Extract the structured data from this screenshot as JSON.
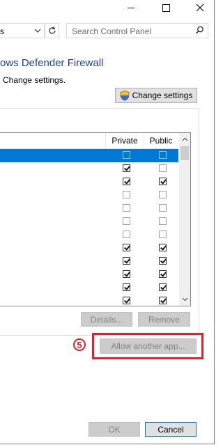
{
  "address": {
    "text": "s"
  },
  "search": {
    "placeholder": "Search Control Panel"
  },
  "header": {
    "title": "ows Defender Firewall",
    "subtitle": "Change settings."
  },
  "buttons": {
    "change_settings": "Change settings",
    "details": "Details...",
    "remove": "Remove",
    "allow_another_app": "Allow another app...",
    "ok": "OK",
    "cancel": "Cancel"
  },
  "table": {
    "columns": {
      "private": "Private",
      "public": "Public"
    },
    "rows": [
      {
        "selected": true,
        "private": false,
        "public": false
      },
      {
        "selected": false,
        "private": true,
        "public": false
      },
      {
        "selected": false,
        "private": true,
        "public": true
      },
      {
        "selected": false,
        "private": false,
        "public": false
      },
      {
        "selected": false,
        "private": false,
        "public": false
      },
      {
        "selected": false,
        "private": false,
        "public": false
      },
      {
        "selected": false,
        "private": false,
        "public": false
      },
      {
        "selected": false,
        "private": true,
        "public": true
      },
      {
        "selected": false,
        "private": true,
        "public": true
      },
      {
        "selected": false,
        "private": true,
        "public": true
      },
      {
        "selected": false,
        "private": true,
        "public": true
      },
      {
        "selected": false,
        "private": true,
        "public": true
      }
    ]
  },
  "annotation": {
    "step": "5"
  },
  "colors": {
    "accent": "#0078d7",
    "annotation": "#e0202a",
    "title": "#1e3e9a"
  }
}
